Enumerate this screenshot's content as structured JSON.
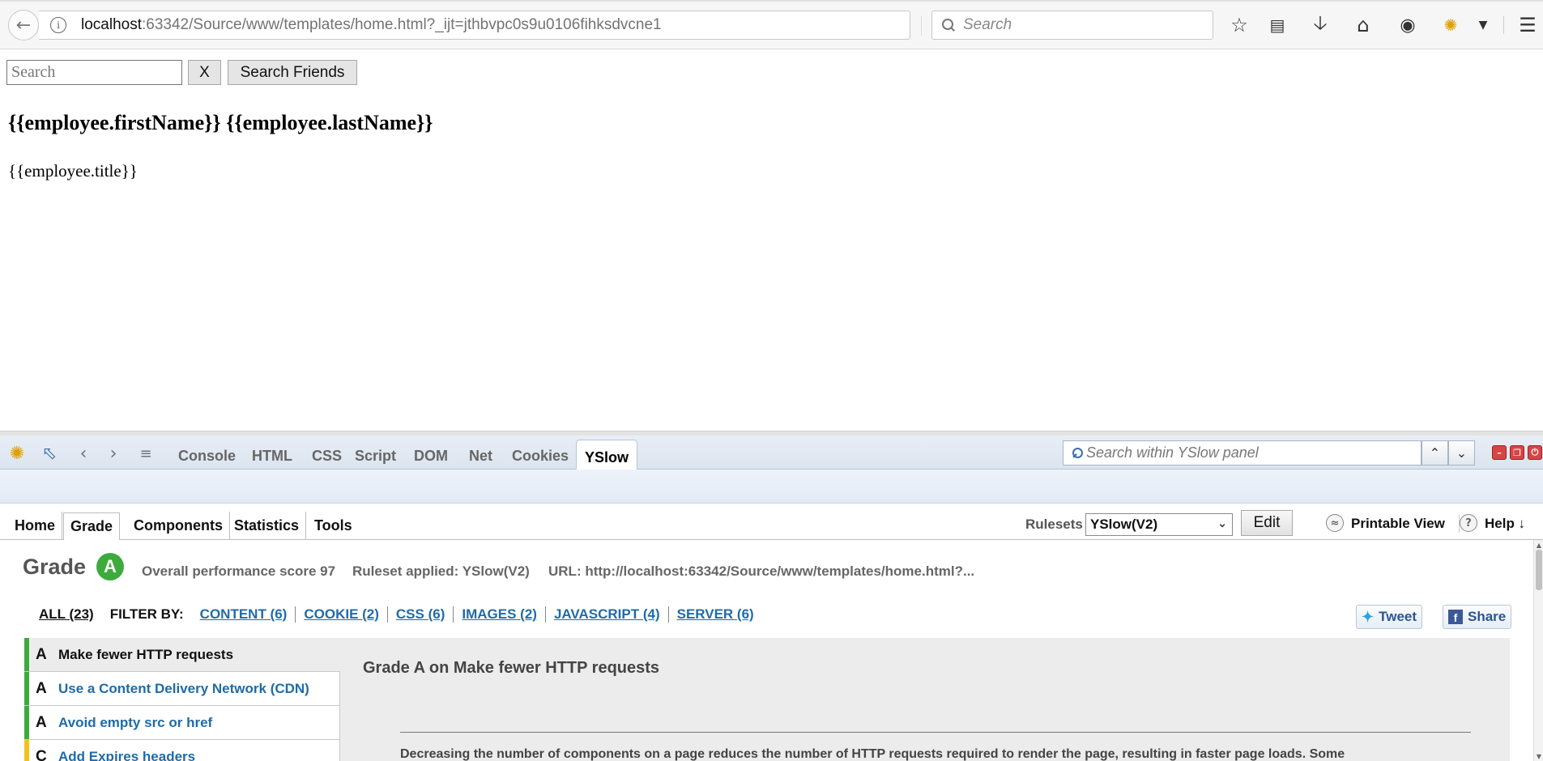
{
  "browser": {
    "url_host": "localhost",
    "url_rest": ":63342/Source/www/templates/home.html?_ijt=jthbvpc0s9u0106fihksdvcne1",
    "search_placeholder": "Search"
  },
  "page": {
    "search_placeholder": "Search",
    "clear_label": "X",
    "search_button": "Search Friends",
    "employee_name": "{{employee.firstName}} {{employee.lastName}}",
    "employee_title": "{{employee.title}}"
  },
  "firebug": {
    "tabs": [
      "Console",
      "HTML",
      "CSS",
      "Script",
      "DOM",
      "Net",
      "Cookies",
      "YSlow"
    ],
    "active_tab": "YSlow",
    "search_placeholder": "Search within YSlow panel"
  },
  "yslow": {
    "nav": [
      "Home",
      "Grade",
      "Components",
      "Statistics",
      "Tools"
    ],
    "active_nav": "Grade",
    "rulesets_label": "Rulesets",
    "ruleset_value": "YSlow(V2)",
    "edit_label": "Edit",
    "printable_view": "Printable View",
    "help": "Help ↓",
    "grade_label": "Grade",
    "grade_value": "A",
    "overall_score": "Overall performance score 97",
    "ruleset_applied": "Ruleset applied: YSlow(V2)",
    "url_label": "URL: http://localhost:63342/Source/www/templates/home.html?...",
    "filter_all": "ALL (23)",
    "filter_by": "FILTER BY:",
    "filters": [
      "CONTENT (6)",
      "COOKIE (2)",
      "CSS (6)",
      "IMAGES (2)",
      "JAVASCRIPT (4)",
      "SERVER (6)"
    ],
    "tweet": "Tweet",
    "share": "Share",
    "rules": [
      {
        "grade": "A",
        "label": "Make fewer HTTP requests",
        "color": "#3cab3c"
      },
      {
        "grade": "A",
        "label": "Use a Content Delivery Network (CDN)",
        "color": "#3cab3c"
      },
      {
        "grade": "A",
        "label": "Avoid empty src or href",
        "color": "#3cab3c"
      },
      {
        "grade": "C",
        "label": "Add Expires headers",
        "color": "#f2c21b"
      }
    ],
    "detail_title": "Grade A on Make fewer HTTP requests",
    "detail_text": "Decreasing the number of components on a page reduces the number of HTTP requests required to render the page, resulting in faster page loads. Some"
  }
}
